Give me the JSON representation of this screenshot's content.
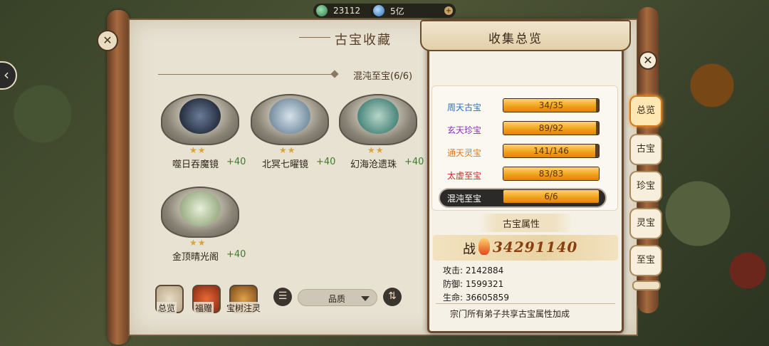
{
  "resources": {
    "jade": "23112",
    "water": "5亿"
  },
  "scroll": {
    "title": "古宝收藏",
    "section_title": "混沌至宝(6/6)"
  },
  "items": [
    {
      "name": "噬日吞魔镜",
      "stars": "★★",
      "bonus": "+40"
    },
    {
      "name": "北冥七曜镜",
      "stars": "★★",
      "bonus": "+40"
    },
    {
      "name": "幻海沧遗珠",
      "stars": "★★",
      "bonus": "+40"
    },
    {
      "name": "金顶晴光阁",
      "stars": "★★",
      "bonus": "+40"
    }
  ],
  "toolbar": {
    "overview": "总览",
    "gift": "福赠",
    "tree": "宝树注灵",
    "quality": "品质"
  },
  "panel": {
    "title": "收集总览",
    "collections": [
      {
        "label": "周天古宝",
        "value": "34/35",
        "progress": 0.971,
        "color": "#2a6fc0"
      },
      {
        "label": "玄天珍宝",
        "value": "89/92",
        "progress": 0.967,
        "color": "#8a2fb8"
      },
      {
        "label": "通天灵宝",
        "value": "141/146",
        "progress": 0.966,
        "color": "#e0781a"
      },
      {
        "label": "太虚至宝",
        "value": "83/83",
        "progress": 1.0,
        "color": "#d0282a"
      },
      {
        "label": "混沌至宝",
        "value": "6/6",
        "progress": 1.0,
        "color": "#ffffff"
      }
    ],
    "attr_title": "古宝属性",
    "power_badge": "战",
    "power_value": "34291140",
    "stats": [
      {
        "label": "攻击:",
        "value": "2142884"
      },
      {
        "label": "防御:",
        "value": "1599321"
      },
      {
        "label": "生命:",
        "value": "36605859"
      }
    ],
    "footer": "宗门所有弟子共享古宝属性加成"
  },
  "tabs": [
    "总览",
    "古宝",
    "珍宝",
    "灵宝",
    "至宝"
  ]
}
